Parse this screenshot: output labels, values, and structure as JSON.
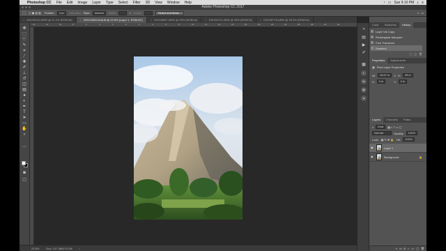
{
  "menubar": {
    "apple": "",
    "app": "Photoshop CC",
    "items": [
      "File",
      "Edit",
      "Image",
      "Layer",
      "Type",
      "Select",
      "Filter",
      "3D",
      "View",
      "Window",
      "Help"
    ],
    "clock": "Sun 9:10 PM"
  },
  "window": {
    "title": "Adobe Photoshop CC 2017"
  },
  "options": {
    "feather_label": "Feather:",
    "feather_value": "0 px",
    "antialias_label": "Anti-alias",
    "style_label": "Style:",
    "style_value": "Normal",
    "width_label": "Width:",
    "height_label": "Height:",
    "select_mask_button": "Select and Mask..."
  },
  "tabs": [
    {
      "label": "DSC00112.ARW @ 21.2% (RGB/16)",
      "active": false
    },
    {
      "label": "DSC03253-Edit.tif @ 22.5% (Layer 1, RGB/16*)",
      "active": true
    },
    {
      "label": "DSC08967.ARW @ 25% (RGB/16)",
      "active": false
    },
    {
      "label": "DSC06741.ARW @ 25% (RGB/16)",
      "active": false
    },
    {
      "label": "DSC09778.ARW @ 33.3% (RGB/16)",
      "active": false
    }
  ],
  "ruler": {
    "top": [
      "14",
      "12",
      "10",
      "8",
      "6",
      "4",
      "2",
      "0",
      "2",
      "4",
      "6",
      "8",
      "10",
      "12",
      "14",
      "16",
      "18",
      "20",
      "22",
      "24",
      "26",
      "28",
      "30",
      "32"
    ]
  },
  "status": {
    "zoom": "22.5%",
    "doc": "Doc: 137.3M/274.7M"
  },
  "history_panel": {
    "tabs": [
      "Color",
      "Swatches",
      "History"
    ],
    "active_tab": "History",
    "items": [
      {
        "label": "Layer Via Copy",
        "selected": false
      },
      {
        "label": "Rectangular Marquee",
        "selected": false
      },
      {
        "label": "Free Transform",
        "selected": false
      },
      {
        "label": "Deselect",
        "selected": true
      }
    ]
  },
  "properties_panel": {
    "tabs": [
      "Properties",
      "Adjustments"
    ],
    "active_tab": "Properties",
    "heading": "Pixel Layer Properties",
    "w_label": "W:",
    "w_value": "18.67 in",
    "h_label": "H:",
    "h_value": "28 in",
    "x_label": "X:",
    "x_value": "0 in",
    "y_label": "Y:",
    "y_value": "0 in",
    "go_label": "GO"
  },
  "layers_panel": {
    "tabs": [
      "Layers",
      "Channels",
      "Paths"
    ],
    "active_tab": "Layers",
    "kind": "Kind",
    "blend_mode": "Normal",
    "opacity_label": "Opacity:",
    "opacity_value": "100%",
    "lock_label": "Lock:",
    "fill_label": "Fill:",
    "fill_value": "100%",
    "layers": [
      {
        "name": "Layer 1",
        "selected": true
      },
      {
        "name": "Background",
        "selected": false
      }
    ]
  },
  "colors": {
    "menubar": "#dcdcdc",
    "panel": "#535353",
    "workspace": "#282828",
    "selection": "#6d6d6d"
  }
}
